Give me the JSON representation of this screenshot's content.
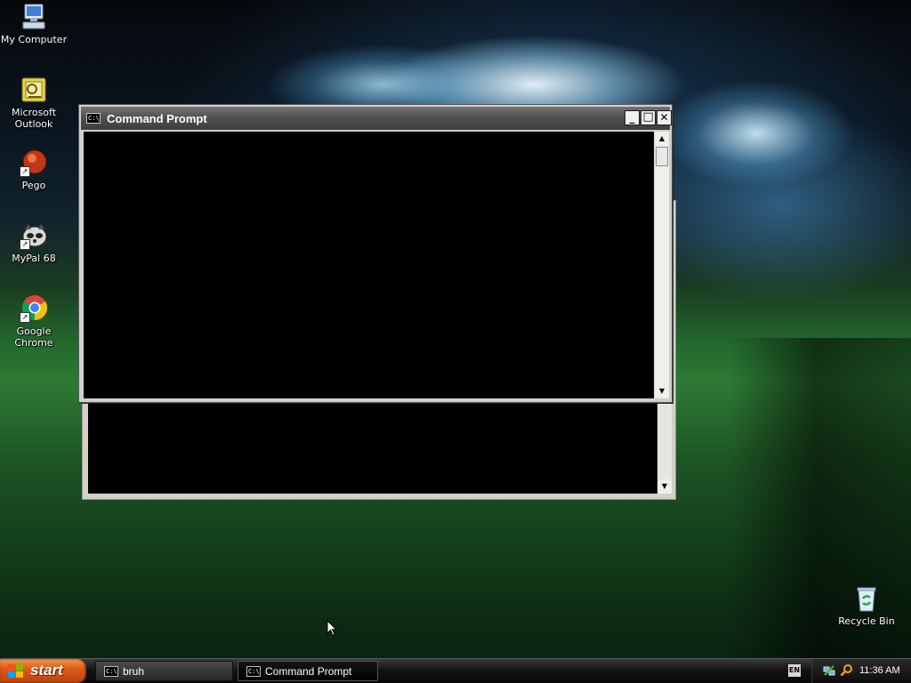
{
  "desktop": {
    "icons": [
      {
        "label": "My Computer",
        "icon": "computer-icon"
      },
      {
        "label": "Microsoft Outlook",
        "icon": "outlook-icon"
      },
      {
        "label": "Pego",
        "icon": "pego-icon"
      },
      {
        "label": "MyPal 68",
        "icon": "mypal-icon"
      },
      {
        "label": "Google Chrome",
        "icon": "chrome-icon"
      },
      {
        "label": "Recycle Bin",
        "icon": "recycle-bin-icon"
      }
    ]
  },
  "window": {
    "title": "Command Prompt",
    "icon_text": "C:\\",
    "minimize": "_",
    "maximize": "□",
    "close": "✕"
  },
  "taskbar": {
    "start_label": "start",
    "tasks": [
      {
        "label": "bruh",
        "icon": "cmd-icon"
      },
      {
        "label": "Command Prompt",
        "icon": "cmd-icon",
        "active": true
      }
    ],
    "language": "EN",
    "clock": "11:36 AM"
  },
  "colors": {
    "start_button": "#de5a1a",
    "console_bg": "#000000",
    "titlebar": "#4e4e4e"
  }
}
